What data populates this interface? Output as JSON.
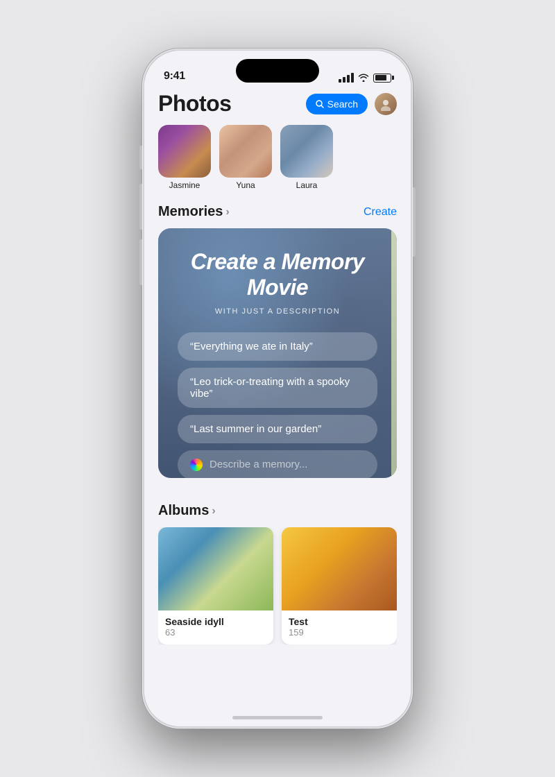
{
  "statusBar": {
    "time": "9:41",
    "batteryLevel": "80"
  },
  "header": {
    "title": "Photos",
    "searchLabel": "Search"
  },
  "people": [
    {
      "name": "Jasmine",
      "colorClass": "person-photo-jasmine"
    },
    {
      "name": "Yuna",
      "colorClass": "person-photo-yuna"
    },
    {
      "name": "Laura",
      "colorClass": "person-photo-laura"
    }
  ],
  "memoriesSection": {
    "title": "Memories",
    "actionLabel": "Create"
  },
  "memoryCard": {
    "title": "Create a Memory Movie",
    "subtitle": "WITH JUST A DESCRIPTION",
    "suggestions": [
      "“Everything we ate in Italy”",
      "“Leo trick-or-treating with a spooky vibe”",
      "“Last summer in our garden”"
    ],
    "inputPlaceholder": "Describe a memory..."
  },
  "albumsSection": {
    "title": "Albums"
  },
  "albums": [
    {
      "name": "Seaside idyll",
      "count": "63",
      "colorClass": "album-thumb-seaside"
    },
    {
      "name": "Test",
      "count": "159",
      "colorClass": "album-thumb-test"
    }
  ]
}
